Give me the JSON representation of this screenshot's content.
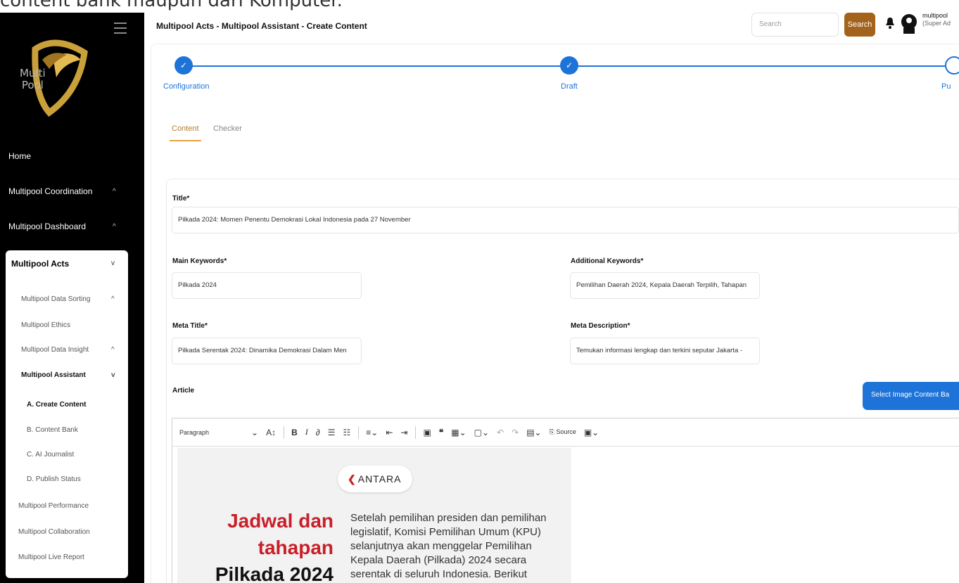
{
  "caption": "content bank maupun dari Komputer.",
  "sidebar": {
    "logo_text": "Multi\nPool",
    "menu": [
      {
        "label": "Home"
      },
      {
        "label": "Multipool Coordination",
        "chevron": "^"
      },
      {
        "label": "Multipool Dashboard",
        "chevron": "^"
      }
    ],
    "section": {
      "label": "Multipool Acts",
      "chevron": "v",
      "items": [
        {
          "label": "Multipool Data Sorting",
          "chevron": "^"
        },
        {
          "label": "Multipool Ethics"
        },
        {
          "label": "Multipool Data Insight",
          "chevron": "^"
        },
        {
          "label": "Multipool Assistant",
          "chevron": "v"
        },
        {
          "label": "Multipool Performance"
        },
        {
          "label": "Multipool Collaboration"
        },
        {
          "label": "Multipool Live Report"
        }
      ],
      "assistant_items": [
        {
          "label": "A. Create Content"
        },
        {
          "label": "B. Content Bank"
        },
        {
          "label": "C. AI Journalist"
        },
        {
          "label": "D. Publish Status"
        }
      ]
    }
  },
  "header": {
    "title": "Multipool Acts - Multipool Assistant - Create Content",
    "search_placeholder": "Search",
    "search_button": "Search",
    "user_name": "multipool",
    "user_role": "(Super Ad"
  },
  "stepper": {
    "steps": [
      {
        "label": "Configuration",
        "check": "✓"
      },
      {
        "label": "Draft",
        "check": "✓"
      },
      {
        "label": "Pu"
      }
    ]
  },
  "tabs": [
    {
      "label": "Content"
    },
    {
      "label": "Checker"
    }
  ],
  "form": {
    "title_label": "Title*",
    "title_value": "Pilkada 2024: Momen Penentu Demokrasi Lokal Indonesia pada 27 November",
    "main_keywords_label": "Main Keywords*",
    "main_keywords_value": "Pilkada 2024",
    "additional_keywords_label": "Additional Keywords*",
    "additional_keywords_value": "Pemilihan Daerah 2024, Kepala Daerah Terpilih, Tahapan",
    "meta_title_label": "Meta Title*",
    "meta_title_value": "Pilkada Serentak 2024: Dinamika Demokrasi Dalam Men",
    "meta_description_label": "Meta Description*",
    "meta_description_value": "Temukan informasi lengkap dan terkini seputar Jakarta -",
    "article_label": "Article",
    "select_image_button": "Select Image Content Ba"
  },
  "editor": {
    "paragraph": "Paragraph",
    "source": "Source",
    "article": {
      "brand": "ANTARA",
      "headline_1": "Jadwal dan",
      "headline_2": "tahapan",
      "headline_3": "Pilkada 2024",
      "body": "Setelah pemilihan presiden dan pemilihan legislatif, Komisi Pemilihan Umum (KPU) selanjutnya akan menggelar Pemilihan Kepala Daerah (Pilkada) 2024 secara serentak di seluruh Indonesia. Berikut"
    }
  },
  "colors": {
    "accent_blue": "#1e73d8",
    "search_brown": "#a4631c",
    "tab_orange": "#e8a245",
    "headline_red": "#c8202a",
    "sidebar_black": "#000000"
  }
}
